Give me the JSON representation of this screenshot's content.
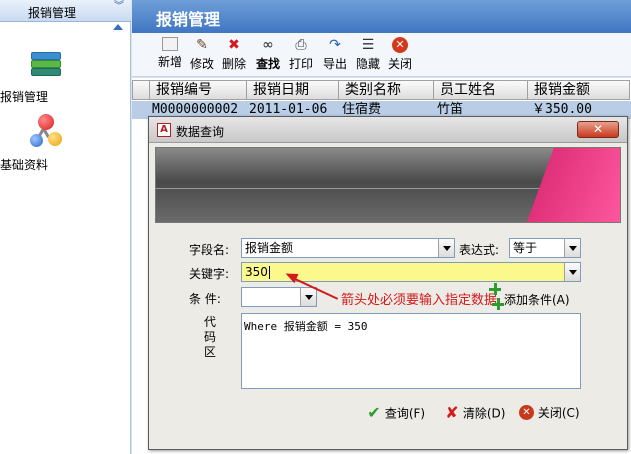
{
  "nav": {
    "header": "报销管理",
    "items": [
      {
        "label": "报销管理",
        "icon": "books-icon"
      },
      {
        "label": "基础资料",
        "icon": "molecule-icon"
      }
    ]
  },
  "main": {
    "title": "报销管理",
    "toolbar": [
      {
        "label": "新增",
        "icon": "new-icon"
      },
      {
        "label": "修改",
        "icon": "edit-icon"
      },
      {
        "label": "删除",
        "icon": "delete-icon"
      },
      {
        "label": "查找",
        "icon": "binoculars-icon"
      },
      {
        "label": "打印",
        "icon": "printer-icon"
      },
      {
        "label": "导出",
        "icon": "export-icon"
      },
      {
        "label": "隐藏",
        "icon": "hide-icon"
      },
      {
        "label": "关闭",
        "icon": "close-icon"
      }
    ],
    "columns": [
      "报销编号",
      "报销日期",
      "类别名称",
      "员工姓名",
      "报销金额"
    ],
    "rows": [
      [
        "M0000000002",
        "2011-01-06",
        "住宿费",
        "竹笛",
        "￥350.00"
      ]
    ]
  },
  "dialog": {
    "title": "数据查询",
    "close_label": "✕",
    "field_label": "字段名:",
    "field_value": "报销金额",
    "expr_label": "表达式:",
    "expr_value": "等于",
    "keyword_label": "关键字:",
    "keyword_value": "350",
    "condition_label": "条 件:",
    "condition_value": "",
    "add_condition": "添加条件(A)",
    "annotation": "箭头处必须要输入指定数据",
    "code_label": "代码区",
    "code_text": "Where 报销金额 = 350",
    "buttons": [
      {
        "label": "查询(F)",
        "icon": "check-icon",
        "color": "#2e9b2e"
      },
      {
        "label": "清除(D)",
        "icon": "clear-icon",
        "color": "#d4191b"
      },
      {
        "label": "关闭(C)",
        "icon": "close-icon",
        "color": "#c8391c"
      }
    ]
  }
}
